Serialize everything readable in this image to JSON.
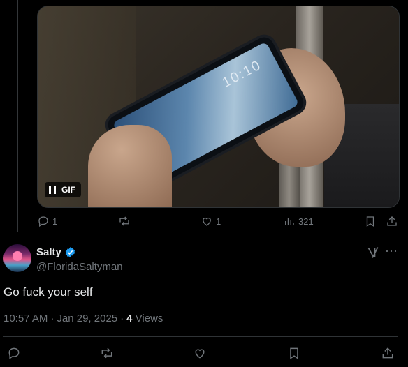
{
  "media": {
    "badge_label": "GIF",
    "screen_text": "10:10"
  },
  "parent_actions": {
    "reply_count": "1",
    "repost_count": "",
    "like_count": "1",
    "view_count": "321"
  },
  "tweet": {
    "display_name": "Salty",
    "handle": "@FloridaSaltyman",
    "text": "Go fuck your self",
    "time": "10:57 AM",
    "date": "Jan 29, 2025",
    "views_count": "4",
    "views_label": "Views",
    "separator": "·"
  },
  "colors": {
    "background": "#000000",
    "text": "#e7e9ea",
    "muted": "#71767b",
    "verified": "#1d9bf0",
    "border": "#2f3336"
  },
  "icons": [
    "reply-icon",
    "repost-icon",
    "like-icon",
    "views-icon",
    "bookmark-icon",
    "share-icon",
    "pause-icon",
    "verified-badge-icon",
    "grok-icon",
    "more-icon"
  ]
}
